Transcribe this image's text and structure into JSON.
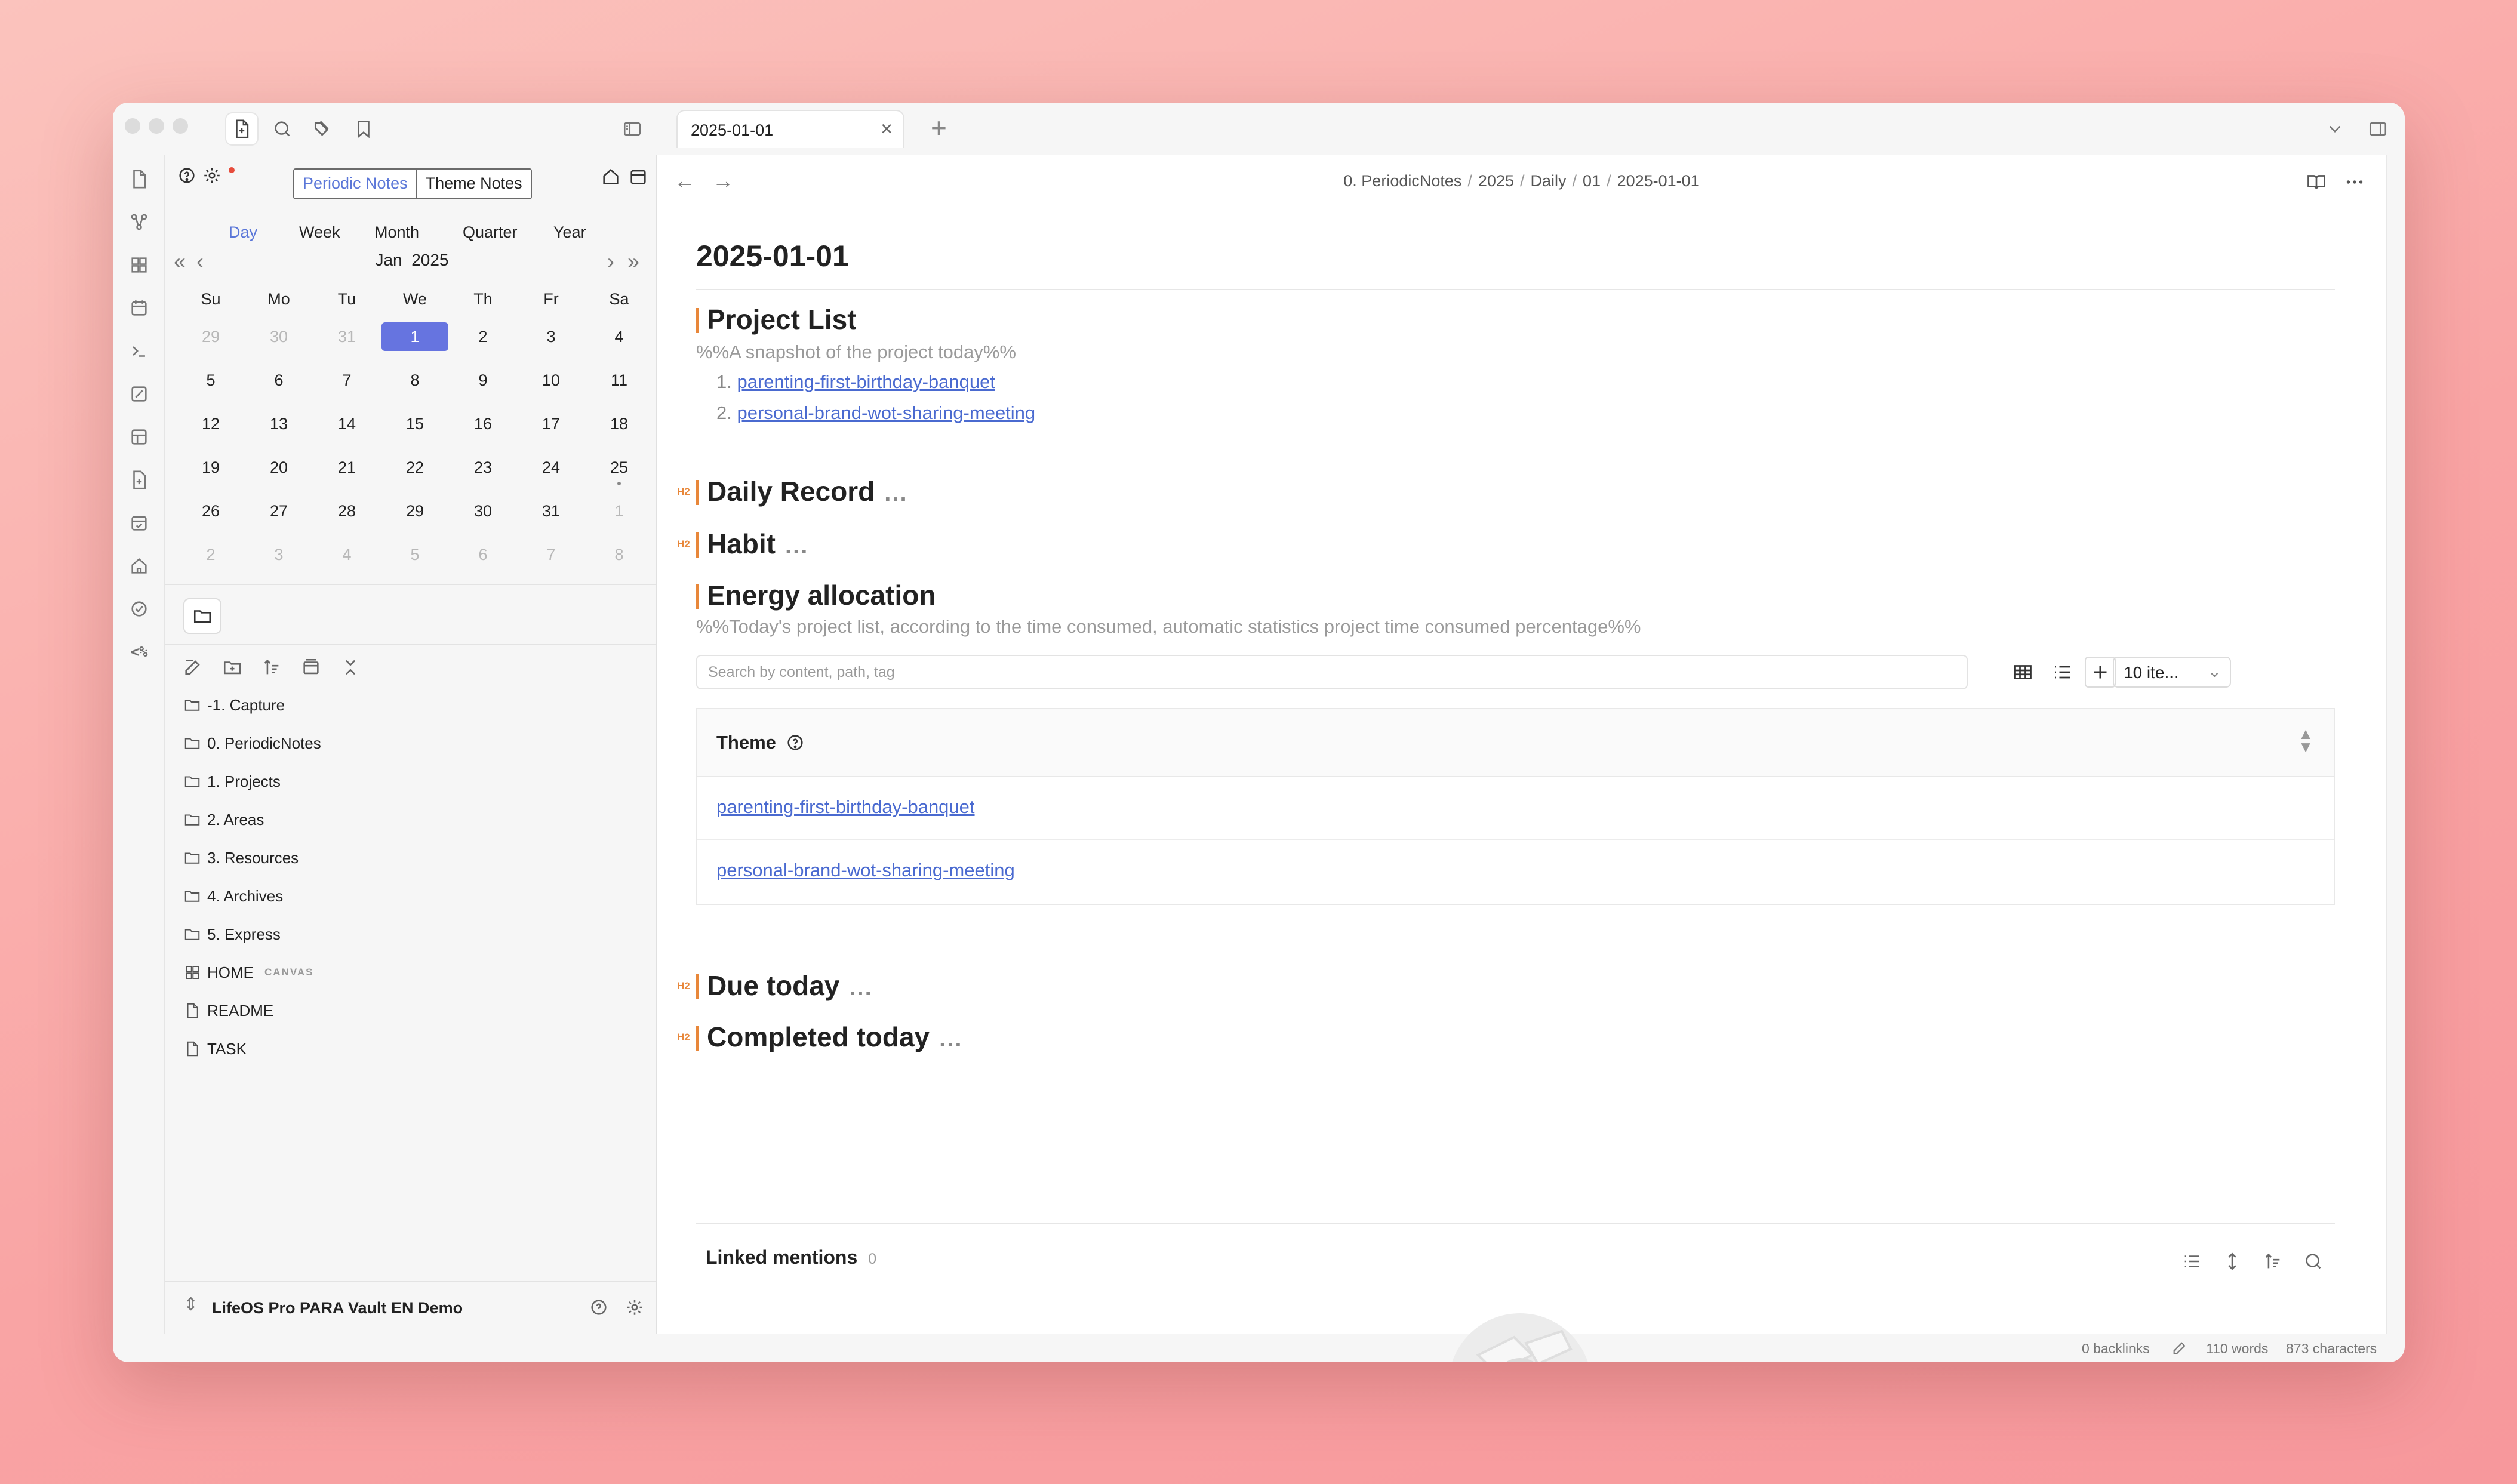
{
  "tab": {
    "title": "2025-01-01"
  },
  "ribbon": {
    "template_text": "<%"
  },
  "calendar": {
    "toggle": {
      "periodic": "Periodic Notes",
      "theme": "Theme Notes"
    },
    "periods": [
      "Day",
      "Week",
      "Month",
      "Quarter",
      "Year"
    ],
    "month": "Jan",
    "year": "2025",
    "weekdays": [
      "Su",
      "Mo",
      "Tu",
      "We",
      "Th",
      "Fr",
      "Sa"
    ],
    "weeks": [
      [
        "29",
        "30",
        "31",
        "1",
        "2",
        "3",
        "4"
      ],
      [
        "5",
        "6",
        "7",
        "8",
        "9",
        "10",
        "11"
      ],
      [
        "12",
        "13",
        "14",
        "15",
        "16",
        "17",
        "18"
      ],
      [
        "19",
        "20",
        "21",
        "22",
        "23",
        "24",
        "25"
      ],
      [
        "26",
        "27",
        "28",
        "29",
        "30",
        "31",
        "1"
      ],
      [
        "2",
        "3",
        "4",
        "5",
        "6",
        "7",
        "8"
      ]
    ],
    "muted": [
      [
        0,
        0
      ],
      [
        0,
        1
      ],
      [
        0,
        2
      ],
      [
        4,
        6
      ],
      [
        5,
        0
      ],
      [
        5,
        1
      ],
      [
        5,
        2
      ],
      [
        5,
        3
      ],
      [
        5,
        4
      ],
      [
        5,
        5
      ],
      [
        5,
        6
      ]
    ],
    "today": [
      0,
      3
    ],
    "dots": [
      [
        3,
        6
      ]
    ]
  },
  "files": [
    {
      "type": "folder",
      "name": "-1. Capture"
    },
    {
      "type": "folder",
      "name": "0. PeriodicNotes"
    },
    {
      "type": "folder",
      "name": "1. Projects"
    },
    {
      "type": "folder",
      "name": "2. Areas"
    },
    {
      "type": "folder",
      "name": "3. Resources"
    },
    {
      "type": "folder",
      "name": "4. Archives"
    },
    {
      "type": "folder",
      "name": "5. Express"
    },
    {
      "type": "canvas",
      "name": "HOME",
      "badge": "CANVAS"
    },
    {
      "type": "file",
      "name": "README"
    },
    {
      "type": "file",
      "name": "TASK"
    }
  ],
  "vault": {
    "name": "LifeOS Pro PARA Vault EN Demo"
  },
  "breadcrumb": [
    "0. PeriodicNotes",
    "2025",
    "Daily",
    "01",
    "2025-01-01"
  ],
  "note": {
    "title": "2025-01-01",
    "project_list": {
      "heading": "Project List",
      "comment": "%%A snapshot of the project today%%",
      "items": [
        "parenting-first-birthday-banquet",
        "personal-brand-wot-sharing-meeting"
      ]
    },
    "h2_marker": "H2",
    "more": "...",
    "daily_record": "Daily Record",
    "habit": "Habit",
    "energy": {
      "heading": "Energy allocation",
      "comment": "%%Today's project list, according to the time consumed, automatic statistics project time consumed percentage%%",
      "search_placeholder": "Search by content, path, tag",
      "items_select": "10 ite...",
      "table_header": "Theme",
      "rows": [
        "parenting-first-birthday-banquet",
        "personal-brand-wot-sharing-meeting"
      ]
    },
    "due_today": "Due today",
    "completed_today": "Completed today"
  },
  "linked_mentions": {
    "label": "Linked mentions",
    "count": "0"
  },
  "status": {
    "backlinks": "0 backlinks",
    "words": "110 words",
    "characters": "873 characters"
  }
}
